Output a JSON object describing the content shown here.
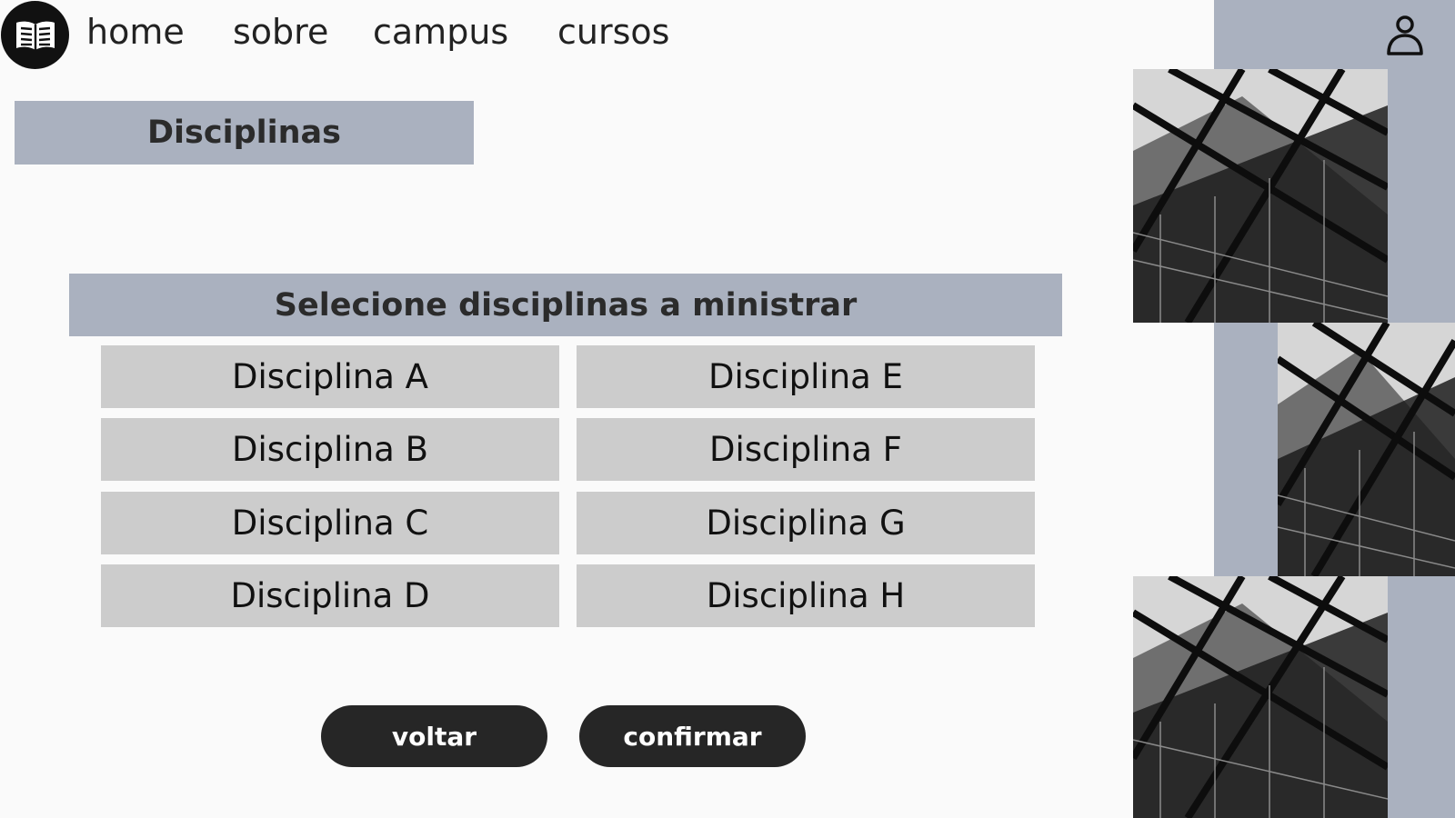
{
  "nav": {
    "logo_icon": "open-book-icon",
    "links": [
      "home",
      "sobre",
      "campus",
      "cursos"
    ],
    "user_icon": "user-icon"
  },
  "page_title": "Disciplinas",
  "panel": {
    "header": "Selecione disciplinas a ministrar",
    "options": [
      "Disciplina A",
      "Disciplina E",
      "Disciplina B",
      "Disciplina F",
      "Disciplina C",
      "Disciplina G",
      "Disciplina D",
      "Disciplina H"
    ]
  },
  "buttons": {
    "back": "voltar",
    "confirm": "confirmar"
  },
  "colors": {
    "accent": "#aab1bf",
    "option_bg": "#cccccc",
    "button_bg": "#262626"
  }
}
